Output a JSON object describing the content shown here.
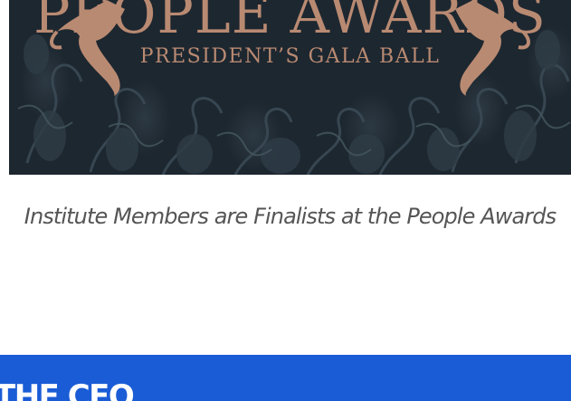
{
  "banner": {
    "title": "PEOPLE AWARDS",
    "subtitle": "PRESIDENT’S GALA BALL",
    "colors": {
      "background": "#1d2730",
      "lettering": "#b98a72"
    }
  },
  "article": {
    "caption": "Institute Members are Finalists at the People Awards"
  },
  "section": {
    "heading": "THE CEO",
    "color": "#1a5cd6"
  }
}
